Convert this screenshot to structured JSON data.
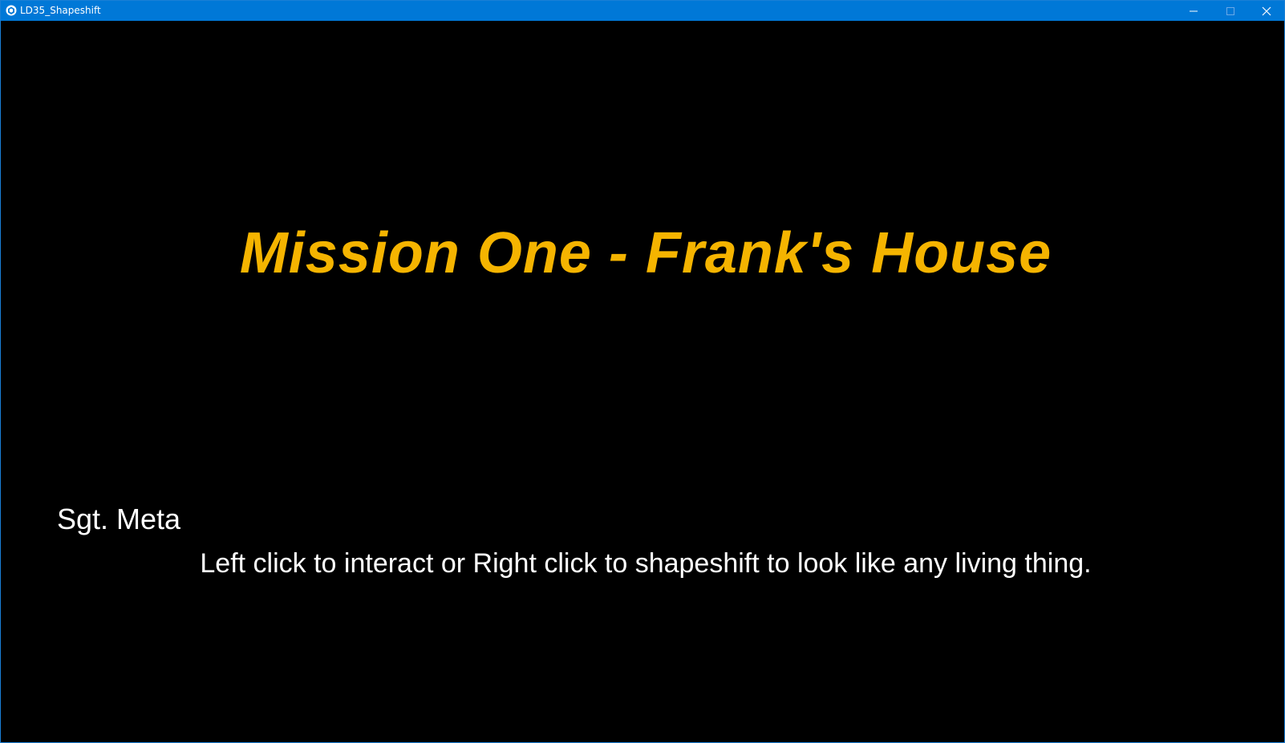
{
  "window": {
    "title": "LD35_Shapeshift",
    "app_icon": "unity-logo-icon",
    "controls": {
      "minimize_icon": "minimize-icon",
      "maximize_icon": "maximize-icon",
      "close_icon": "close-icon"
    }
  },
  "game": {
    "mission_title": "Mission One - Frank's House",
    "speaker": "Sgt. Meta",
    "dialogue": "Left click to interact or Right click to shapeshift to look like any living thing."
  },
  "colors": {
    "titlebar": "#0078d7",
    "background": "#000000",
    "mission_title": "#f5b400",
    "text": "#ffffff"
  }
}
